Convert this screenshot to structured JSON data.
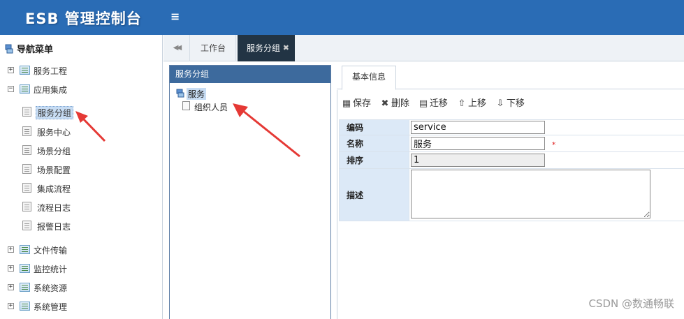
{
  "header": {
    "app_title": "ESB 管理控制台",
    "menu_toggle_icon": "≡"
  },
  "sidebar": {
    "title": "导航菜单",
    "groups": [
      {
        "label": "服务工程",
        "expander": "+"
      },
      {
        "label": "应用集成",
        "expander": "−"
      },
      {
        "label": "文件传输",
        "expander": "+"
      },
      {
        "label": "监控统计",
        "expander": "+"
      },
      {
        "label": "系统资源",
        "expander": "+"
      },
      {
        "label": "系统管理",
        "expander": "+"
      }
    ],
    "app_integration_children": [
      {
        "label": "服务分组",
        "selected": true
      },
      {
        "label": "服务中心"
      },
      {
        "label": "场景分组"
      },
      {
        "label": "场景配置"
      },
      {
        "label": "集成流程"
      },
      {
        "label": "流程日志"
      },
      {
        "label": "报警日志"
      }
    ]
  },
  "tabs": {
    "prev_icon": "◀◀",
    "items": [
      {
        "label": "工作台"
      },
      {
        "label": "服务分组",
        "active": true,
        "close_icon": "✖"
      }
    ]
  },
  "tree_panel": {
    "title": "服务分组",
    "root_label": "服务",
    "child_label": "组织人员"
  },
  "detail": {
    "tab_label": "基本信息",
    "toolbar": [
      {
        "label": "保存",
        "icon": "save-icon"
      },
      {
        "label": "删除",
        "icon": "delete-icon"
      },
      {
        "label": "迁移",
        "icon": "move-icon"
      },
      {
        "label": "上移",
        "icon": "up-icon"
      },
      {
        "label": "下移",
        "icon": "down-icon"
      }
    ],
    "form": {
      "code_label": "编码",
      "code_value": "service",
      "name_label": "名称",
      "name_value": "服务",
      "required_mark": "*",
      "order_label": "排序",
      "order_value": "1",
      "desc_label": "描述",
      "desc_value": ""
    }
  },
  "watermark": "CSDN @数通畅联",
  "colors": {
    "header_bg": "#2a6cb5",
    "panel_header_bg": "#3d6a9d",
    "active_tab_bg": "#223444",
    "form_label_bg": "#dce9f7",
    "annotation_arrow": "#e53935"
  }
}
